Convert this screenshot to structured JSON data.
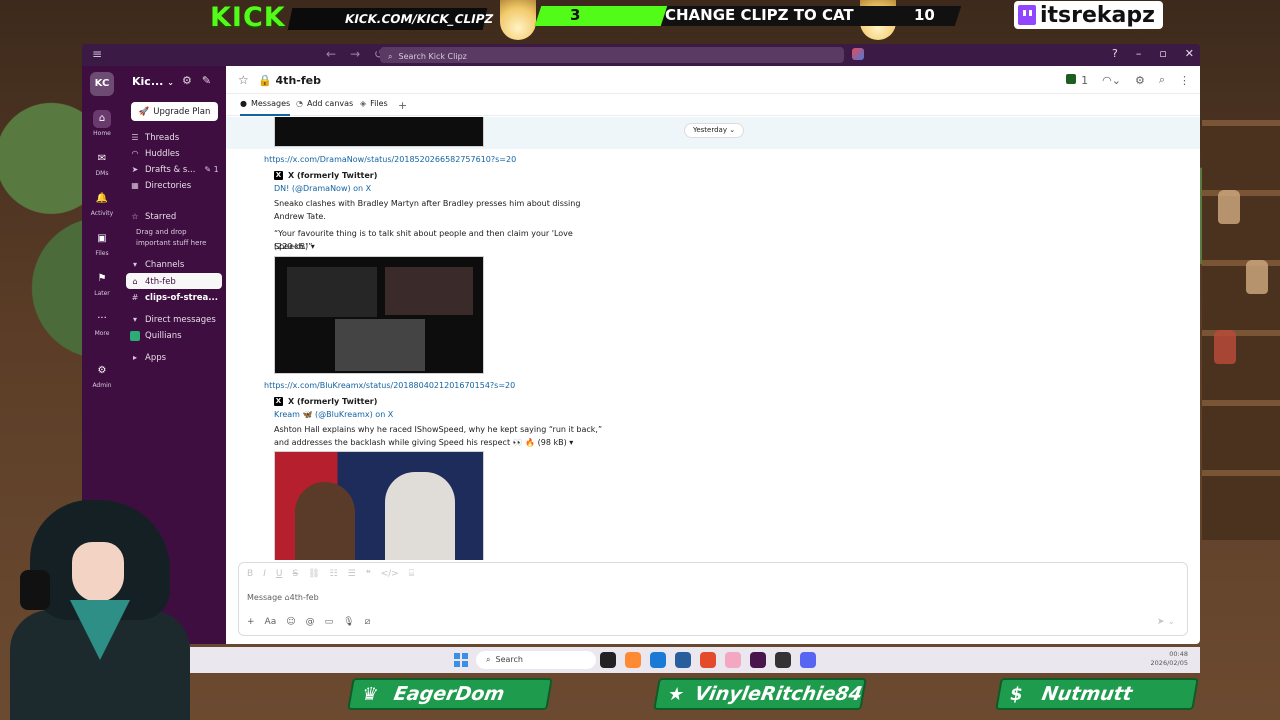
{
  "stream": {
    "kick_logo": "KICK",
    "kick_url": "KICK.COM/KICK_CLIPZ",
    "goal_current": "3",
    "goal_text": "CHANGE CLIPZ TO CAT",
    "goal_target": "10",
    "goal_progress": 0.3,
    "twitch_name": "itsrekapz",
    "badges": [
      {
        "name": "EagerDom",
        "icon": "crown-icon",
        "symbol": "♛"
      },
      {
        "name": "VinyleRitchie84",
        "icon": "star-icon",
        "symbol": "★"
      },
      {
        "name": "Nutmutt",
        "icon": "dollar-icon",
        "symbol": "$"
      }
    ]
  },
  "titlebar": {
    "search_placeholder": "Search Kick Clipz"
  },
  "rail": {
    "workspace_initials": "KC",
    "items": [
      {
        "label": "Home",
        "icon": "home-icon",
        "symbol": "⌂"
      },
      {
        "label": "DMs",
        "icon": "dms-icon",
        "symbol": "✉"
      },
      {
        "label": "Activity",
        "icon": "bell-icon",
        "symbol": "🔔"
      },
      {
        "label": "Files",
        "icon": "files-icon",
        "symbol": "▣"
      },
      {
        "label": "Later",
        "icon": "bookmark-icon",
        "symbol": "⚑"
      },
      {
        "label": "More",
        "icon": "more-icon",
        "symbol": "···"
      },
      {
        "label": "Admin",
        "icon": "gear-icon",
        "symbol": "⚙"
      }
    ]
  },
  "sidebar": {
    "workspace_name": "Kic...",
    "upgrade_label": "Upgrade Plan",
    "threads": "Threads",
    "huddles": "Huddles",
    "drafts": "Drafts & s...",
    "drafts_count": "1",
    "directories": "Directories",
    "starred": "Starred",
    "starred_note": "Drag and drop important stuff here",
    "channels_header": "Channels",
    "channels": [
      "4th-feb",
      "clips-of-strea..."
    ],
    "dm_header": "Direct messages",
    "dm_user": "Quillians",
    "apps": "Apps"
  },
  "channel": {
    "name": "4th-feb",
    "member_count": "1",
    "tabs": [
      "Messages",
      "Add canvas",
      "Files"
    ]
  },
  "messages": {
    "date_divider": "Yesterday",
    "link1": "https://x.com/DramaNow/status/2018520266582757610?s=20",
    "source1": "X (formerly Twitter)",
    "author1": "DN! (@DramaNow) on X",
    "text1a": "Sneako clashes with Bradley Martyn after Bradley presses him about dissing Andrew Tate.",
    "text1b": "“Your favourite thing is to talk shit about people and then claim your 'Love Speech.'”",
    "size1": "(220 kB) ▾",
    "link2": "https://x.com/BluKreamx/status/2018804021201670154?s=20",
    "source2": "X (formerly Twitter)",
    "author2": "Kream 🦋 (@BluKreamx) on X",
    "text2": "Ashton Hall explains why he raced IShowSpeed, why he kept saying “run it back,” and addresses the backlash while giving Speed his respect 👀 🔥 (98 kB) ▾"
  },
  "composer": {
    "placeholder": "Message ⌂4th-feb"
  },
  "taskbar": {
    "search": "Search",
    "time": "00:48",
    "date": "2026/02/05"
  }
}
